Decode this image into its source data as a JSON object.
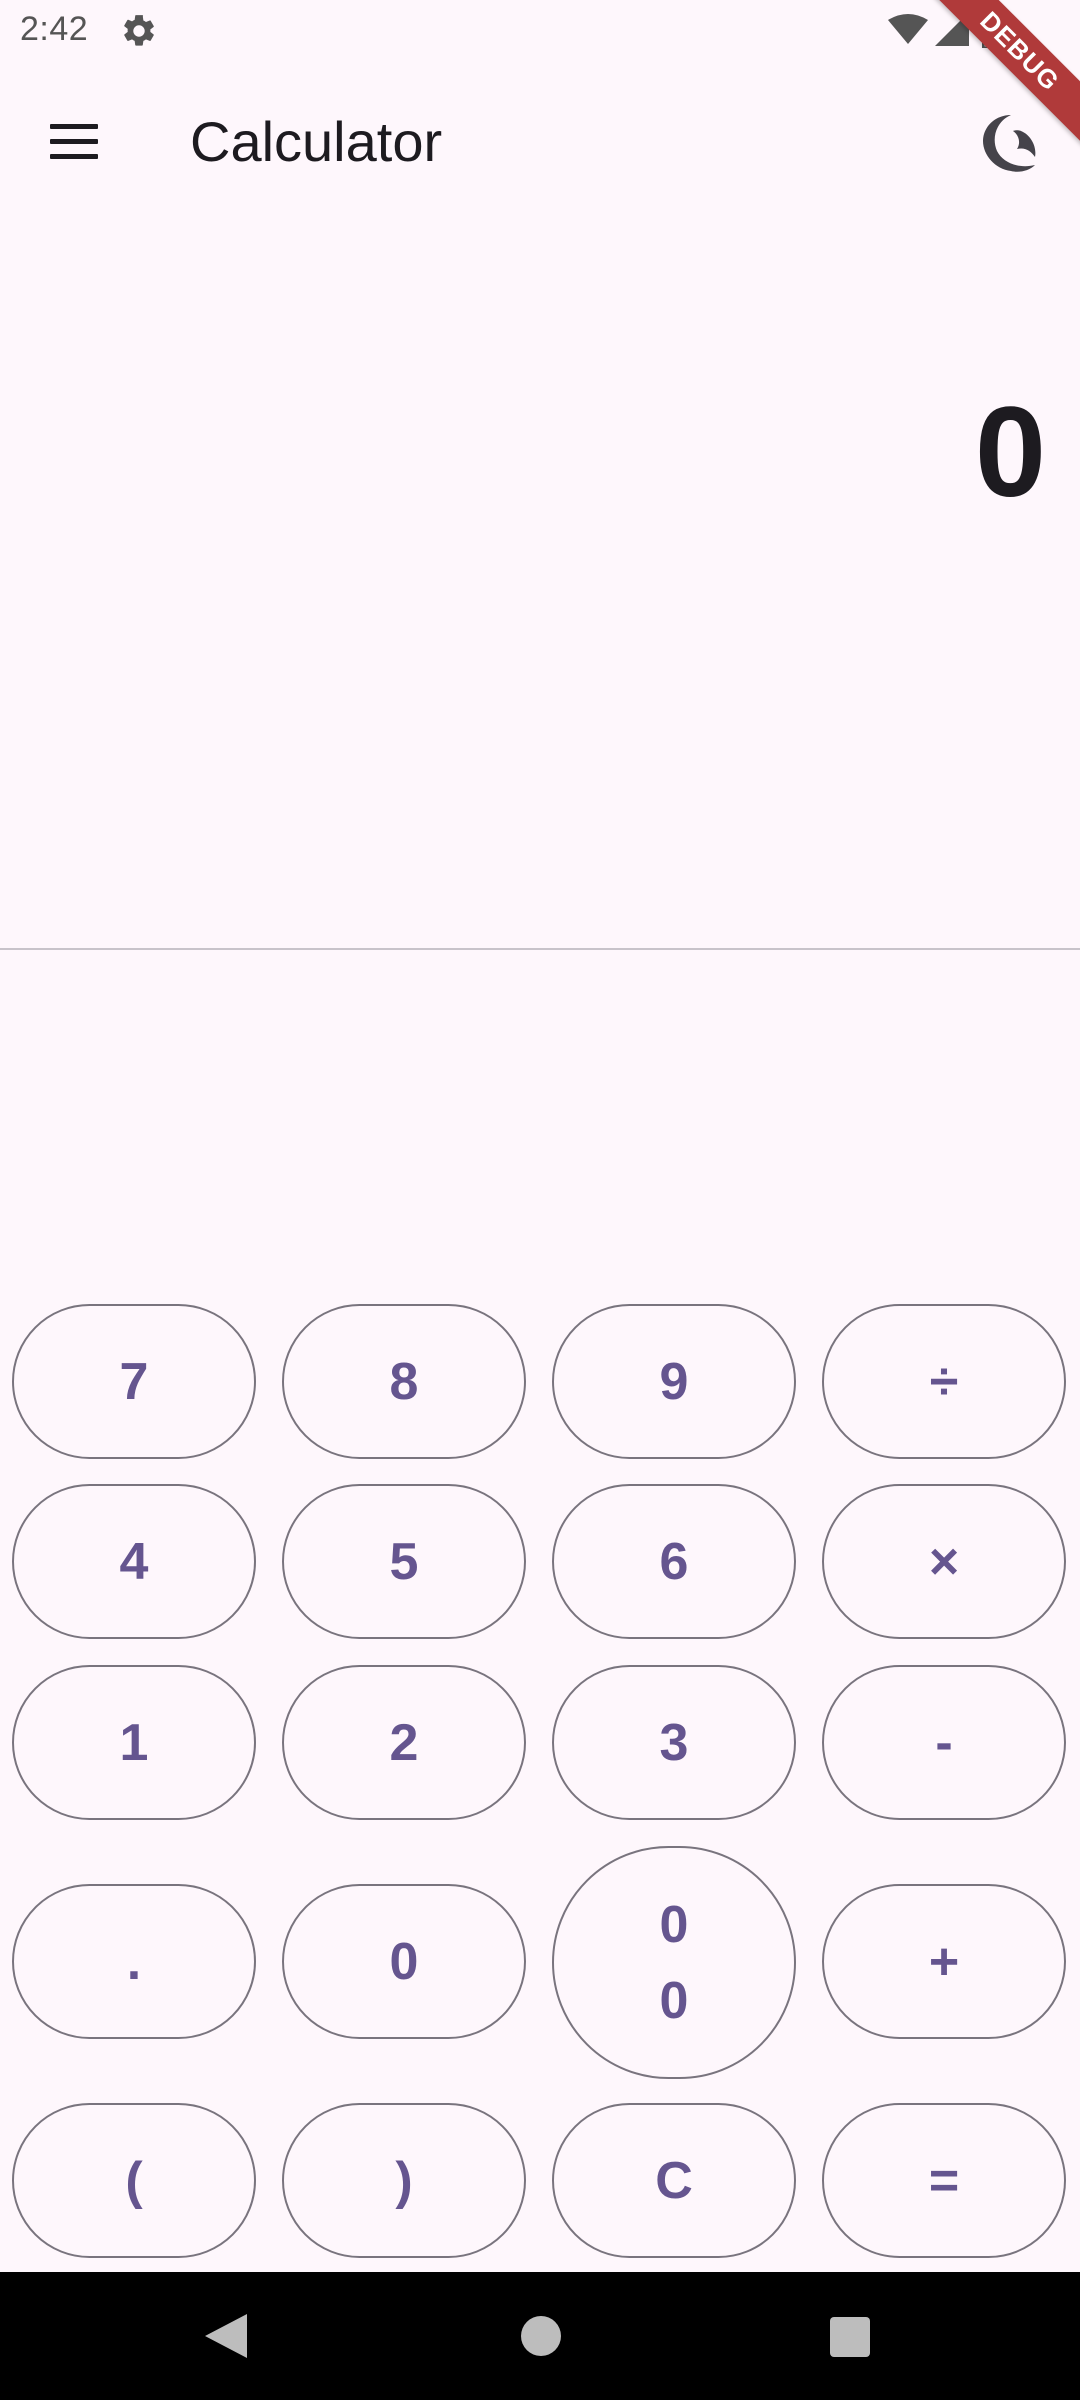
{
  "status_bar": {
    "time": "2:42",
    "settings_icon": "gear-icon",
    "wifi_icon": "wifi-icon",
    "signal_icon": "cell-signal-icon",
    "battery_icon": "battery-icon"
  },
  "debug_banner": "DEBUG",
  "app_bar": {
    "title": "Calculator",
    "menu_icon": "hamburger-menu-icon",
    "theme_icon": "dark-mode-icon"
  },
  "display": {
    "value": "0"
  },
  "keypad": {
    "rows": [
      [
        "7",
        "8",
        "9",
        "÷"
      ],
      [
        "4",
        "5",
        "6",
        "×"
      ],
      [
        "1",
        "2",
        "3",
        "-"
      ],
      [
        ".",
        "0",
        "00",
        "+"
      ],
      [
        "(",
        ")",
        "C",
        "="
      ]
    ],
    "double_zero_line_1": "0",
    "double_zero_line_2": "0"
  },
  "colors": {
    "background": "#FEF7FC",
    "key_text": "#65558F",
    "key_border": "#79747E",
    "text_primary": "#1D1B20",
    "debug_banner": "#B03A3A"
  },
  "nav_bar": {
    "back_icon": "back-triangle-icon",
    "home_icon": "home-circle-icon",
    "recents_icon": "recents-square-icon"
  }
}
